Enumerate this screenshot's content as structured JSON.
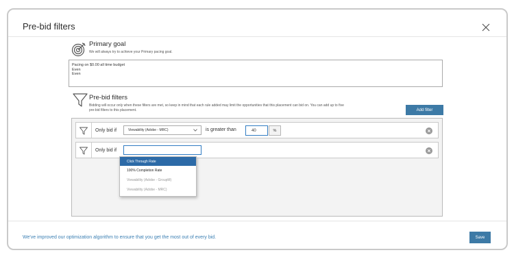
{
  "dialog": {
    "title": "Pre-bid filters"
  },
  "primary_goal": {
    "icon": "target-icon",
    "title": "Primary goal",
    "description": "We will always try to achieve your Primary pacing goal.",
    "box_lines": [
      "Pacing on $0.00 all time budget",
      "Even",
      "Even"
    ]
  },
  "prebid": {
    "icon": "funnel-icon",
    "title": "Pre-bid filters",
    "description_line1": "Bidding will occur only when these filters are met, so keep in mind that each rule added may limit the opportunities that this placement can bid on. You can add up to five",
    "description_line2": "pre-bid filters to this placement.",
    "add_filter_label": "Add filter"
  },
  "rules": [
    {
      "prefix": "Only bid if",
      "metric": "Viewability (Adobe - MRC)",
      "operator": "is greater than",
      "value": "40",
      "unit": "%"
    },
    {
      "prefix": "Only bid if",
      "metric": ""
    }
  ],
  "dropdown": {
    "options": [
      "Click Through Rate",
      "100% Completion Rate",
      "Viewability (Adobe - GroupM)",
      "Viewability (Adobe - MRC)"
    ],
    "highlighted": "Click Through Rate"
  },
  "footer": {
    "message": "We've improved our optimization algorithm to ensure that you get the most out of every bid.",
    "save_label": "Save"
  },
  "colors": {
    "accent": "#3d7aa6",
    "focus": "#2f7bc2",
    "link": "#3b7fb3"
  }
}
